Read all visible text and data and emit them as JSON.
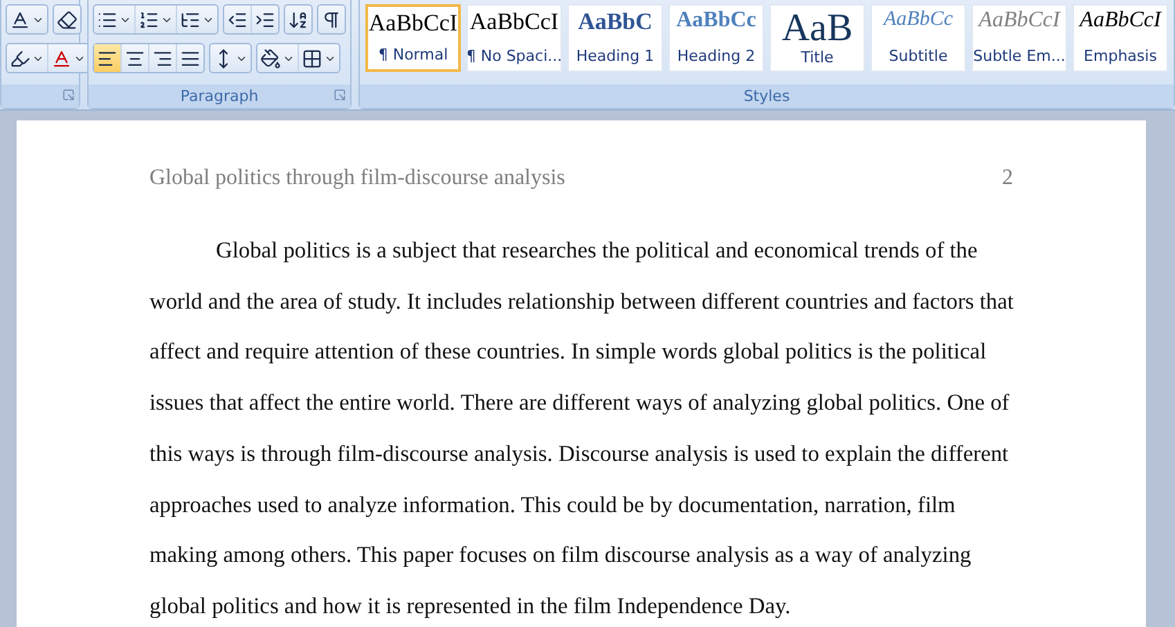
{
  "ribbon": {
    "font_group": {
      "top_buttons": [
        {
          "kind": "grow-font",
          "dropdown": true
        },
        {
          "kind": "clear-format",
          "dropdown": false
        }
      ],
      "bottom_buttons": [
        {
          "kind": "highlight",
          "dropdown": true
        },
        {
          "kind": "font-color",
          "dropdown": true
        }
      ]
    },
    "paragraph_group": {
      "label": "Paragraph",
      "row_1": [
        [
          {
            "kind": "bullets",
            "dropdown": true,
            "selected": false
          },
          {
            "kind": "numbering",
            "dropdown": true,
            "selected": false
          },
          {
            "kind": "multilevel",
            "dropdown": true,
            "selected": false
          }
        ],
        [
          {
            "kind": "outdent",
            "dropdown": false,
            "selected": false
          },
          {
            "kind": "indent",
            "dropdown": false,
            "selected": false
          }
        ],
        [
          {
            "kind": "sort",
            "dropdown": false,
            "selected": false
          }
        ],
        [
          {
            "kind": "pilcrow",
            "dropdown": false,
            "selected": false
          }
        ]
      ],
      "row_2": [
        [
          {
            "kind": "align-left",
            "dropdown": false,
            "selected": true
          },
          {
            "kind": "align-center",
            "dropdown": false,
            "selected": false
          },
          {
            "kind": "align-right",
            "dropdown": false,
            "selected": false
          },
          {
            "kind": "justify",
            "dropdown": false,
            "selected": false
          }
        ],
        [
          {
            "kind": "line-spacing",
            "dropdown": true,
            "selected": false
          }
        ],
        [
          {
            "kind": "shading",
            "dropdown": true,
            "selected": false
          },
          {
            "kind": "borders",
            "dropdown": true,
            "selected": false
          }
        ]
      ]
    },
    "styles_group": {
      "label": "Styles",
      "styles": [
        {
          "kind": "normal",
          "sample": "AaBbCcI",
          "name": "¶ Normal",
          "selected": true
        },
        {
          "kind": "normal",
          "sample": "AaBbCcI",
          "name": "¶ No Spaci...",
          "selected": false
        },
        {
          "kind": "heading1",
          "sample": "AaBbC",
          "name": "Heading 1",
          "selected": false
        },
        {
          "kind": "heading2",
          "sample": "AaBbCc",
          "name": "Heading 2",
          "selected": false
        },
        {
          "kind": "title",
          "sample": "AaB",
          "name": "Title",
          "selected": false
        },
        {
          "kind": "subtitle",
          "sample": "AaBbCc",
          "name": "Subtitle",
          "selected": false
        },
        {
          "kind": "subtle",
          "sample": "AaBbCcI",
          "name": "Subtle Em...",
          "selected": false
        },
        {
          "kind": "emphasis",
          "sample": "AaBbCcI",
          "name": "Emphasis",
          "selected": false
        }
      ]
    }
  },
  "document": {
    "header": {
      "title": "Global politics through film-discourse analysis",
      "page_number": "2"
    },
    "paragraphs": [
      "Global politics is a subject that researches the political and economical trends of the world and the area of study. It includes relationship between different countries and factors that affect and require attention of these countries. In simple words global politics is the political issues that affect the entire world. There are different ways of analyzing global politics. One of this ways is through film-discourse analysis. Discourse analysis is used to explain the different approaches used to analyze information. This could be by documentation, narration, film making among others. This paper focuses on film discourse analysis as a way of analyzing global politics and how it is represented in the film Independence Day."
    ]
  }
}
